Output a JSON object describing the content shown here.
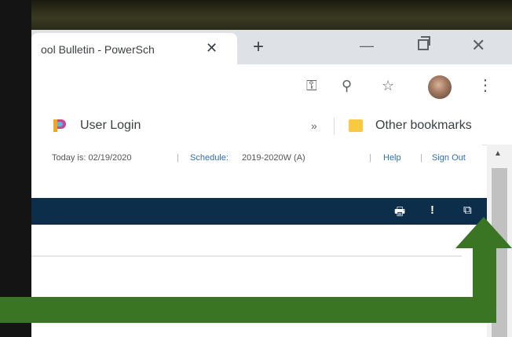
{
  "browser": {
    "tab_title": "ool Bulletin - PowerSch",
    "tab_close": "✕",
    "new_tab": "+",
    "window_minimize": "—",
    "window_close": "✕",
    "toolbar_key": "⚿",
    "toolbar_search": "⚲",
    "toolbar_star": "☆",
    "toolbar_menu": "⋮",
    "bookmarks": {
      "user_login": "User Login",
      "more": "»",
      "other": "Other bookmarks"
    }
  },
  "powerschool": {
    "today": "Today is: 02/19/2020",
    "schedule_label": "Schedule:",
    "schedule_value": "2019-2020W (A)",
    "help": "Help",
    "sign_out": "Sign Out",
    "separator": "|",
    "icons": {
      "print": "🖶",
      "alert": "!",
      "popout": "⧉"
    }
  },
  "scroll": {
    "up": "▲"
  },
  "colors": {
    "nav_band": "#0c2e4a",
    "arrow_green": "#3a7524",
    "link_blue": "#2e6fb7"
  }
}
